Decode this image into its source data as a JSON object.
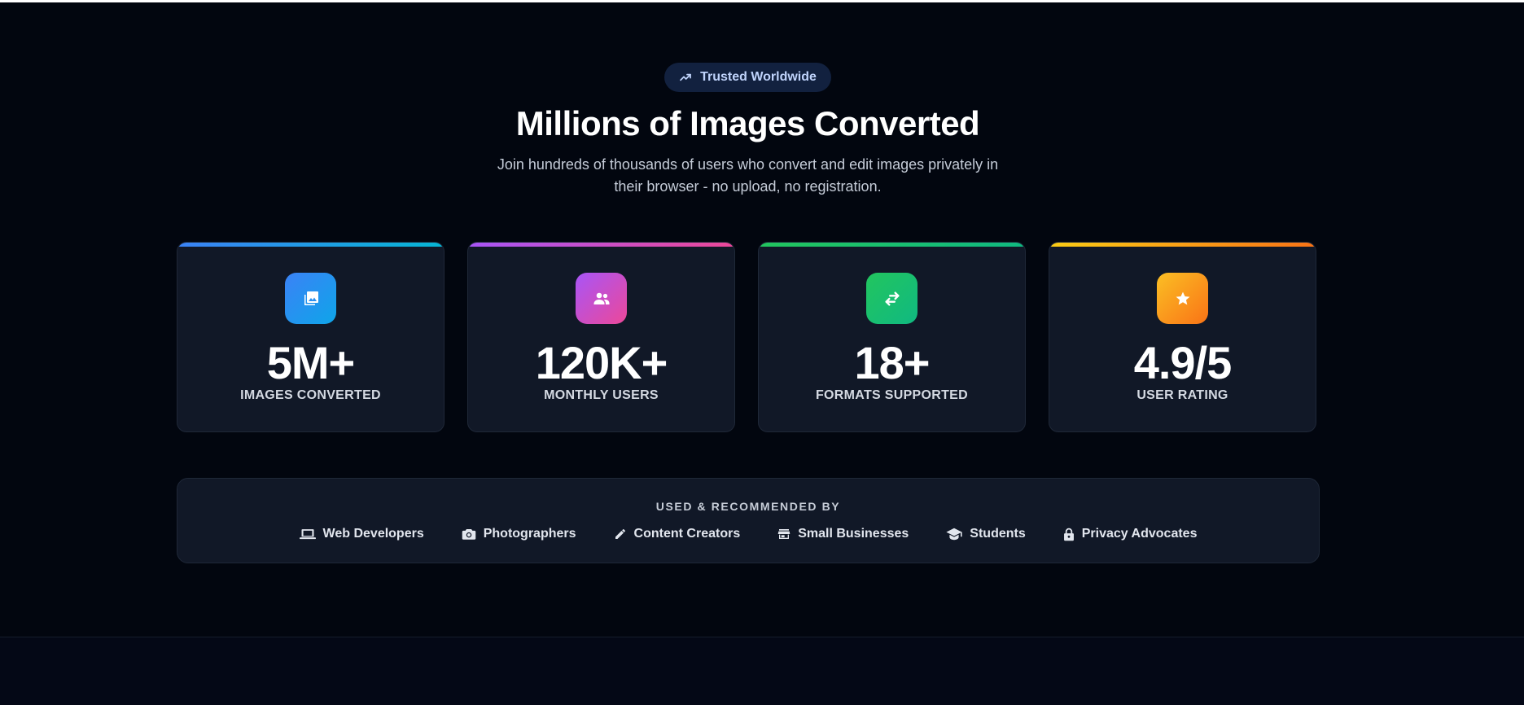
{
  "badge": {
    "label": "Trusted Worldwide",
    "icon": "trending-up-icon"
  },
  "hero": {
    "title": "Millions of Images Converted",
    "subtitle": "Join hundreds of thousands of users who convert and edit images privately in their browser - no upload, no registration."
  },
  "stats": [
    {
      "value": "5M+",
      "label": "IMAGES CONVERTED",
      "icon": "images-icon",
      "accent": [
        "#3b82f6",
        "#06b6d4"
      ],
      "icon_bg": [
        "#3b82f6",
        "#0ea5e9"
      ]
    },
    {
      "value": "120K+",
      "label": "MONTHLY USERS",
      "icon": "users-icon",
      "accent": [
        "#a855f7",
        "#ec4899"
      ],
      "icon_bg": [
        "#a855f7",
        "#ec4899"
      ]
    },
    {
      "value": "18+",
      "label": "FORMATS SUPPORTED",
      "icon": "swap-arrows-icon",
      "accent": [
        "#22c55e",
        "#10b981"
      ],
      "icon_bg": [
        "#22c55e",
        "#10b981"
      ]
    },
    {
      "value": "4.9/5",
      "label": "USER RATING",
      "icon": "star-icon",
      "accent": [
        "#facc15",
        "#f97316"
      ],
      "icon_bg": [
        "#fbbf24",
        "#f97316"
      ]
    }
  ],
  "recommended": {
    "heading": "USED & RECOMMENDED BY",
    "items": [
      {
        "label": "Web Developers",
        "icon": "laptop-icon"
      },
      {
        "label": "Photographers",
        "icon": "camera-icon"
      },
      {
        "label": "Content Creators",
        "icon": "pencil-icon"
      },
      {
        "label": "Small Businesses",
        "icon": "store-icon"
      },
      {
        "label": "Students",
        "icon": "graduation-cap-icon"
      },
      {
        "label": "Privacy Advocates",
        "icon": "lock-icon"
      }
    ]
  },
  "colors": {
    "background": "#02060f",
    "card": "#111827",
    "badge_bg": "#12213f",
    "badge_text": "#bfd3fb"
  }
}
